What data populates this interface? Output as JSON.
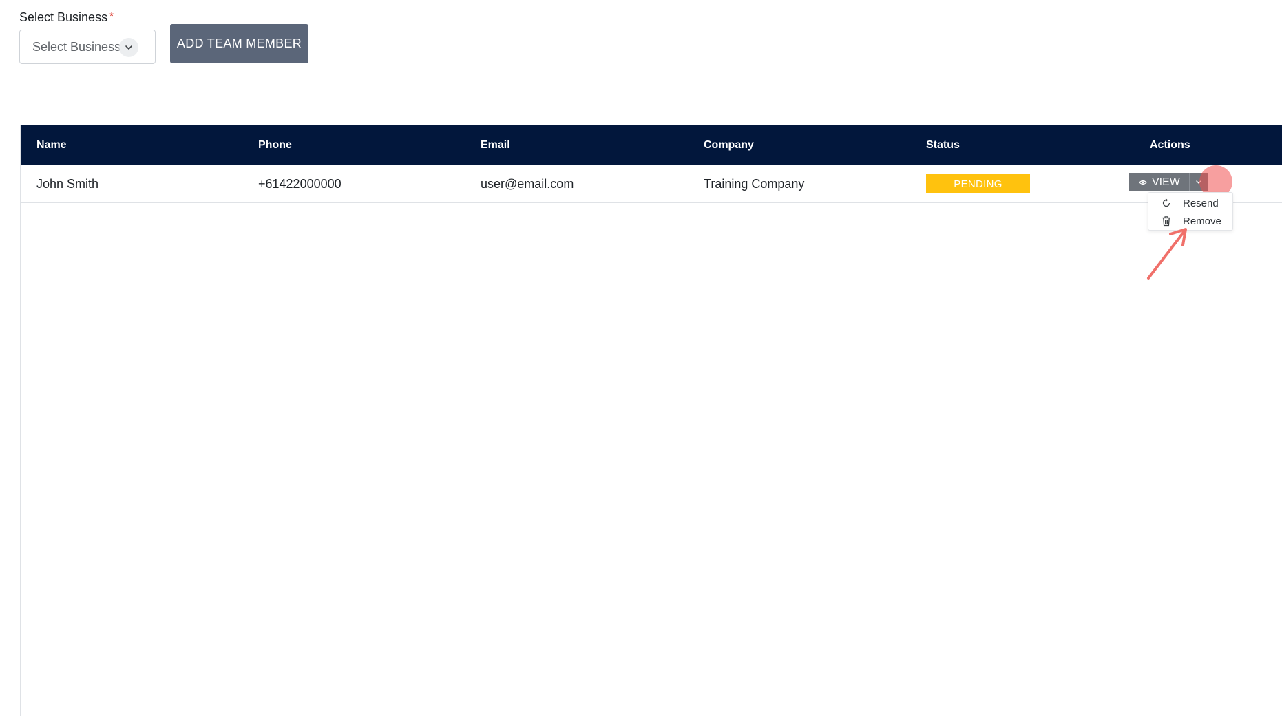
{
  "form": {
    "select_label": "Select Business",
    "required_mark": "*",
    "select_value": "Select Business",
    "add_button_label": "ADD TEAM MEMBER"
  },
  "table": {
    "columns": [
      "Name",
      "Phone",
      "Email",
      "Company",
      "Status",
      "Actions"
    ],
    "rows": [
      {
        "name": "John Smith",
        "phone": "+61422000000",
        "email": "user@email.com",
        "company": "Training Company",
        "status": "PENDING"
      }
    ]
  },
  "actions": {
    "view_label": "VIEW",
    "menu": [
      {
        "label": "Resend",
        "icon": "refresh-icon"
      },
      {
        "label": "Remove",
        "icon": "trash-icon"
      }
    ]
  },
  "colors": {
    "header_bg": "#02173c",
    "add_button_bg": "#5b6679",
    "status_pending": "#ffc20e",
    "view_button_bg": "#6f747b",
    "annotation": "#f0706a"
  }
}
